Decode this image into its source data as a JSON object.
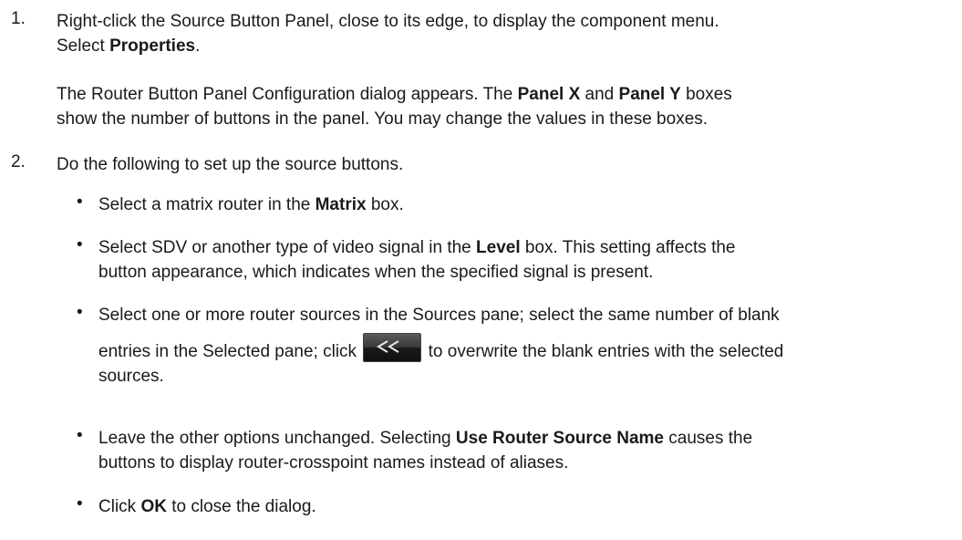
{
  "steps": [
    {
      "number": "1.",
      "text_a": "Right-click the Source Button Panel, close to its edge, to display the component menu.",
      "text_b_prefix": "Select ",
      "text_b_bold": "Properties",
      "text_b_suffix": ".",
      "para2_a": "The Router Button Panel Configuration dialog appears. The ",
      "para2_bold1": "Panel X",
      "para2_mid": " and ",
      "para2_bold2": "Panel Y",
      "para2_b": " boxes",
      "para2_c": "show the number of buttons in the panel. You may change the values in these boxes."
    },
    {
      "number": "2.",
      "text": "Do the following to set up the source buttons."
    }
  ],
  "bullets": {
    "b1_prefix": "Select a matrix router in the ",
    "b1_bold": "Matrix",
    "b1_suffix": " box.",
    "b2_prefix": "Select SDV or another type of video signal in the ",
    "b2_bold": "Level",
    "b2_suffix": " box. This setting affects the",
    "b2_line2": "button appearance, which indicates when the specified signal is present.",
    "b3_line1": "Select one or more router sources in the Sources pane; select the same number of blank",
    "b3_line2_a": "entries in the Selected pane; click ",
    "b3_line2_b": " to overwrite the blank entries with the selected",
    "b3_line3": "sources.",
    "b4_line1_a": "Leave the other options unchanged. Selecting ",
    "b4_bold": "Use Router Source Name",
    "b4_line1_b": " causes the",
    "b4_line2": "buttons to display router-crosspoint names instead of aliases.",
    "b5_prefix": "Click ",
    "b5_bold": "OK",
    "b5_suffix": " to close the dialog."
  },
  "icons": {
    "bullet": "•",
    "add_button": "double-chevron-left-icon"
  }
}
